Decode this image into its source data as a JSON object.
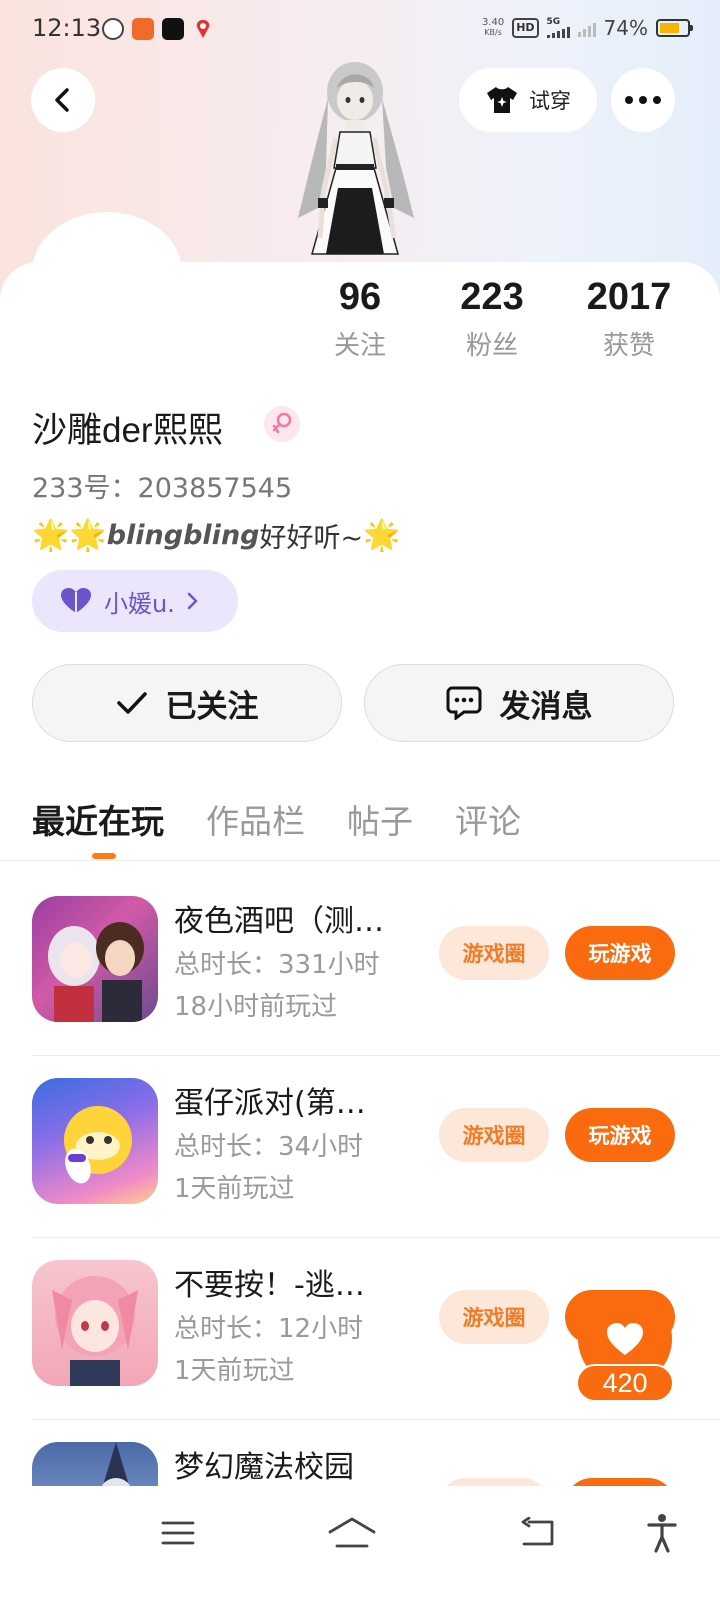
{
  "status_bar": {
    "time": "12:13",
    "net_speed_value": "3.40",
    "net_speed_unit": "KB/s",
    "hd_label": "HD",
    "signal_label": "5G",
    "battery": "74%",
    "battery_level": 0.74
  },
  "header": {
    "try_on_label": "试穿"
  },
  "stats": [
    {
      "value": "96",
      "label": "关注"
    },
    {
      "value": "223",
      "label": "粉丝"
    },
    {
      "value": "2017",
      "label": "获赞"
    }
  ],
  "profile": {
    "name": "沙雕der熙熙",
    "uid": "233号：203857545",
    "bio_prefix": "🌟🌟",
    "bio_bold": "blingbling",
    "bio_text": "好好听~",
    "bio_suffix": "🌟",
    "tag_label": "小媛u."
  },
  "actions": {
    "follow_label": "已关注",
    "message_label": "发消息"
  },
  "tabs": [
    "最近在玩",
    "作品栏",
    "帖子",
    "评论"
  ],
  "games": [
    {
      "title": "夜色酒吧（测…",
      "duration": "总时长：331小时",
      "last_played": "18小时前玩过",
      "circle_label": "游戏圈",
      "play_label": "玩游戏"
    },
    {
      "title": "蛋仔派对(第…",
      "duration": "总时长：34小时",
      "last_played": "1天前玩过",
      "circle_label": "游戏圈",
      "play_label": "玩游戏"
    },
    {
      "title": "不要按！-逃…",
      "duration": "总时长：12小时",
      "last_played": "1天前玩过",
      "circle_label": "游戏圈",
      "play_label": ""
    },
    {
      "title": "梦幻魔法校园",
      "duration": "",
      "last_played": "",
      "circle_label": "",
      "play_label": ""
    }
  ],
  "like_float": {
    "count": "420"
  },
  "colors": {
    "accent": "#fa6b0f",
    "accent_soft": "#fde7d9",
    "tag_bg": "#ebe6fb",
    "tag_fg": "#6a55c9"
  },
  "icons": [
    "back-icon",
    "shirt-icon",
    "more-icon",
    "female-icon",
    "heart-icon",
    "chevron-right-icon",
    "check-icon",
    "chat-icon",
    "menu-icon",
    "home-icon",
    "back-nav-icon",
    "accessibility-icon"
  ]
}
